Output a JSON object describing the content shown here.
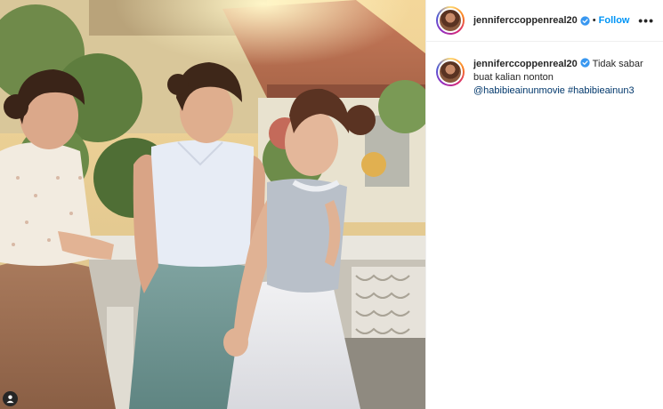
{
  "post": {
    "username": "jenniferccoppenreal20",
    "follow_label": "Follow",
    "separator": "•",
    "more_label": "•••",
    "verified_icon": "verified-badge-icon",
    "tag_icon": "user-tag-icon"
  },
  "caption": {
    "username": "jenniferccoppenreal20",
    "text": "Tidak sabar buat kalian nonton",
    "mention": "@habibieainunmovie",
    "hashtag": "#habibieainun3"
  },
  "colors": {
    "accent": "#0095f6",
    "link": "#00376b",
    "text": "#262626",
    "verified": "#3897f0"
  }
}
